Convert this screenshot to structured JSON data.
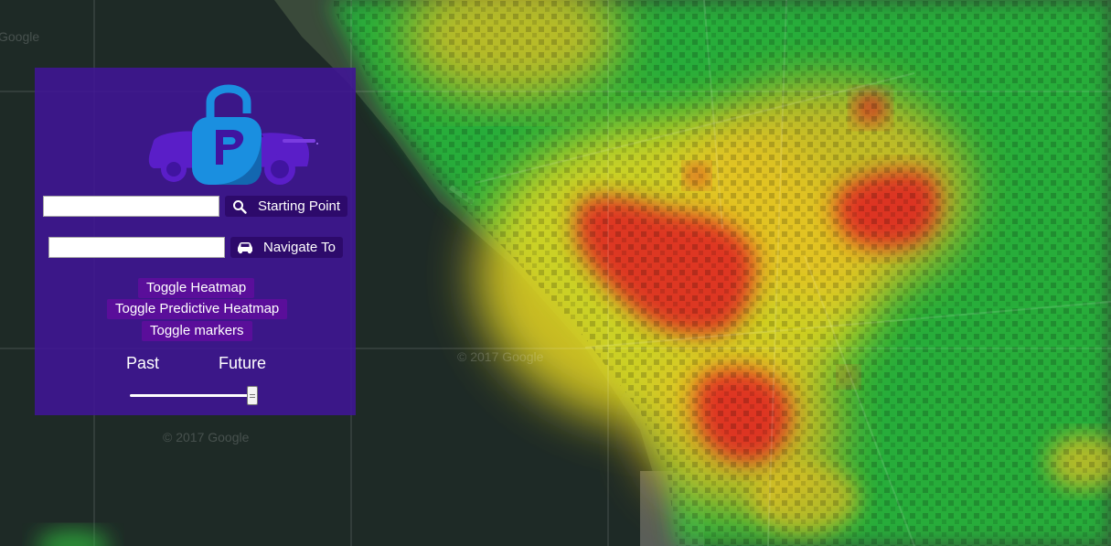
{
  "app": {
    "watermarks": [
      "Google",
      "© 2017 Google",
      "© 2017 Google"
    ]
  },
  "search": {
    "start_value": "",
    "start_label": "Starting Point",
    "start_icon": "search-icon",
    "destination_value": "",
    "destination_label": "Navigate To",
    "destination_icon": "car-icon"
  },
  "toggles": {
    "heatmap": "Toggle Heatmap",
    "predictive": "Toggle Predictive Heatmap",
    "markers": "Toggle markers"
  },
  "time_slider": {
    "left_label": "Past",
    "right_label": "Future",
    "value": 1.0
  },
  "colors": {
    "panel": "#4014a0",
    "button_dark": "#2d0a6b",
    "button_purple": "#5a0e9a",
    "logo_blue": "#1a8fe0",
    "logo_purple": "#5a1ec8",
    "heat_high": "#e62020",
    "heat_mid": "#f0e020",
    "heat_low": "#20d020"
  },
  "icons": [
    "lock-car-logo-icon",
    "search-icon",
    "car-icon"
  ]
}
